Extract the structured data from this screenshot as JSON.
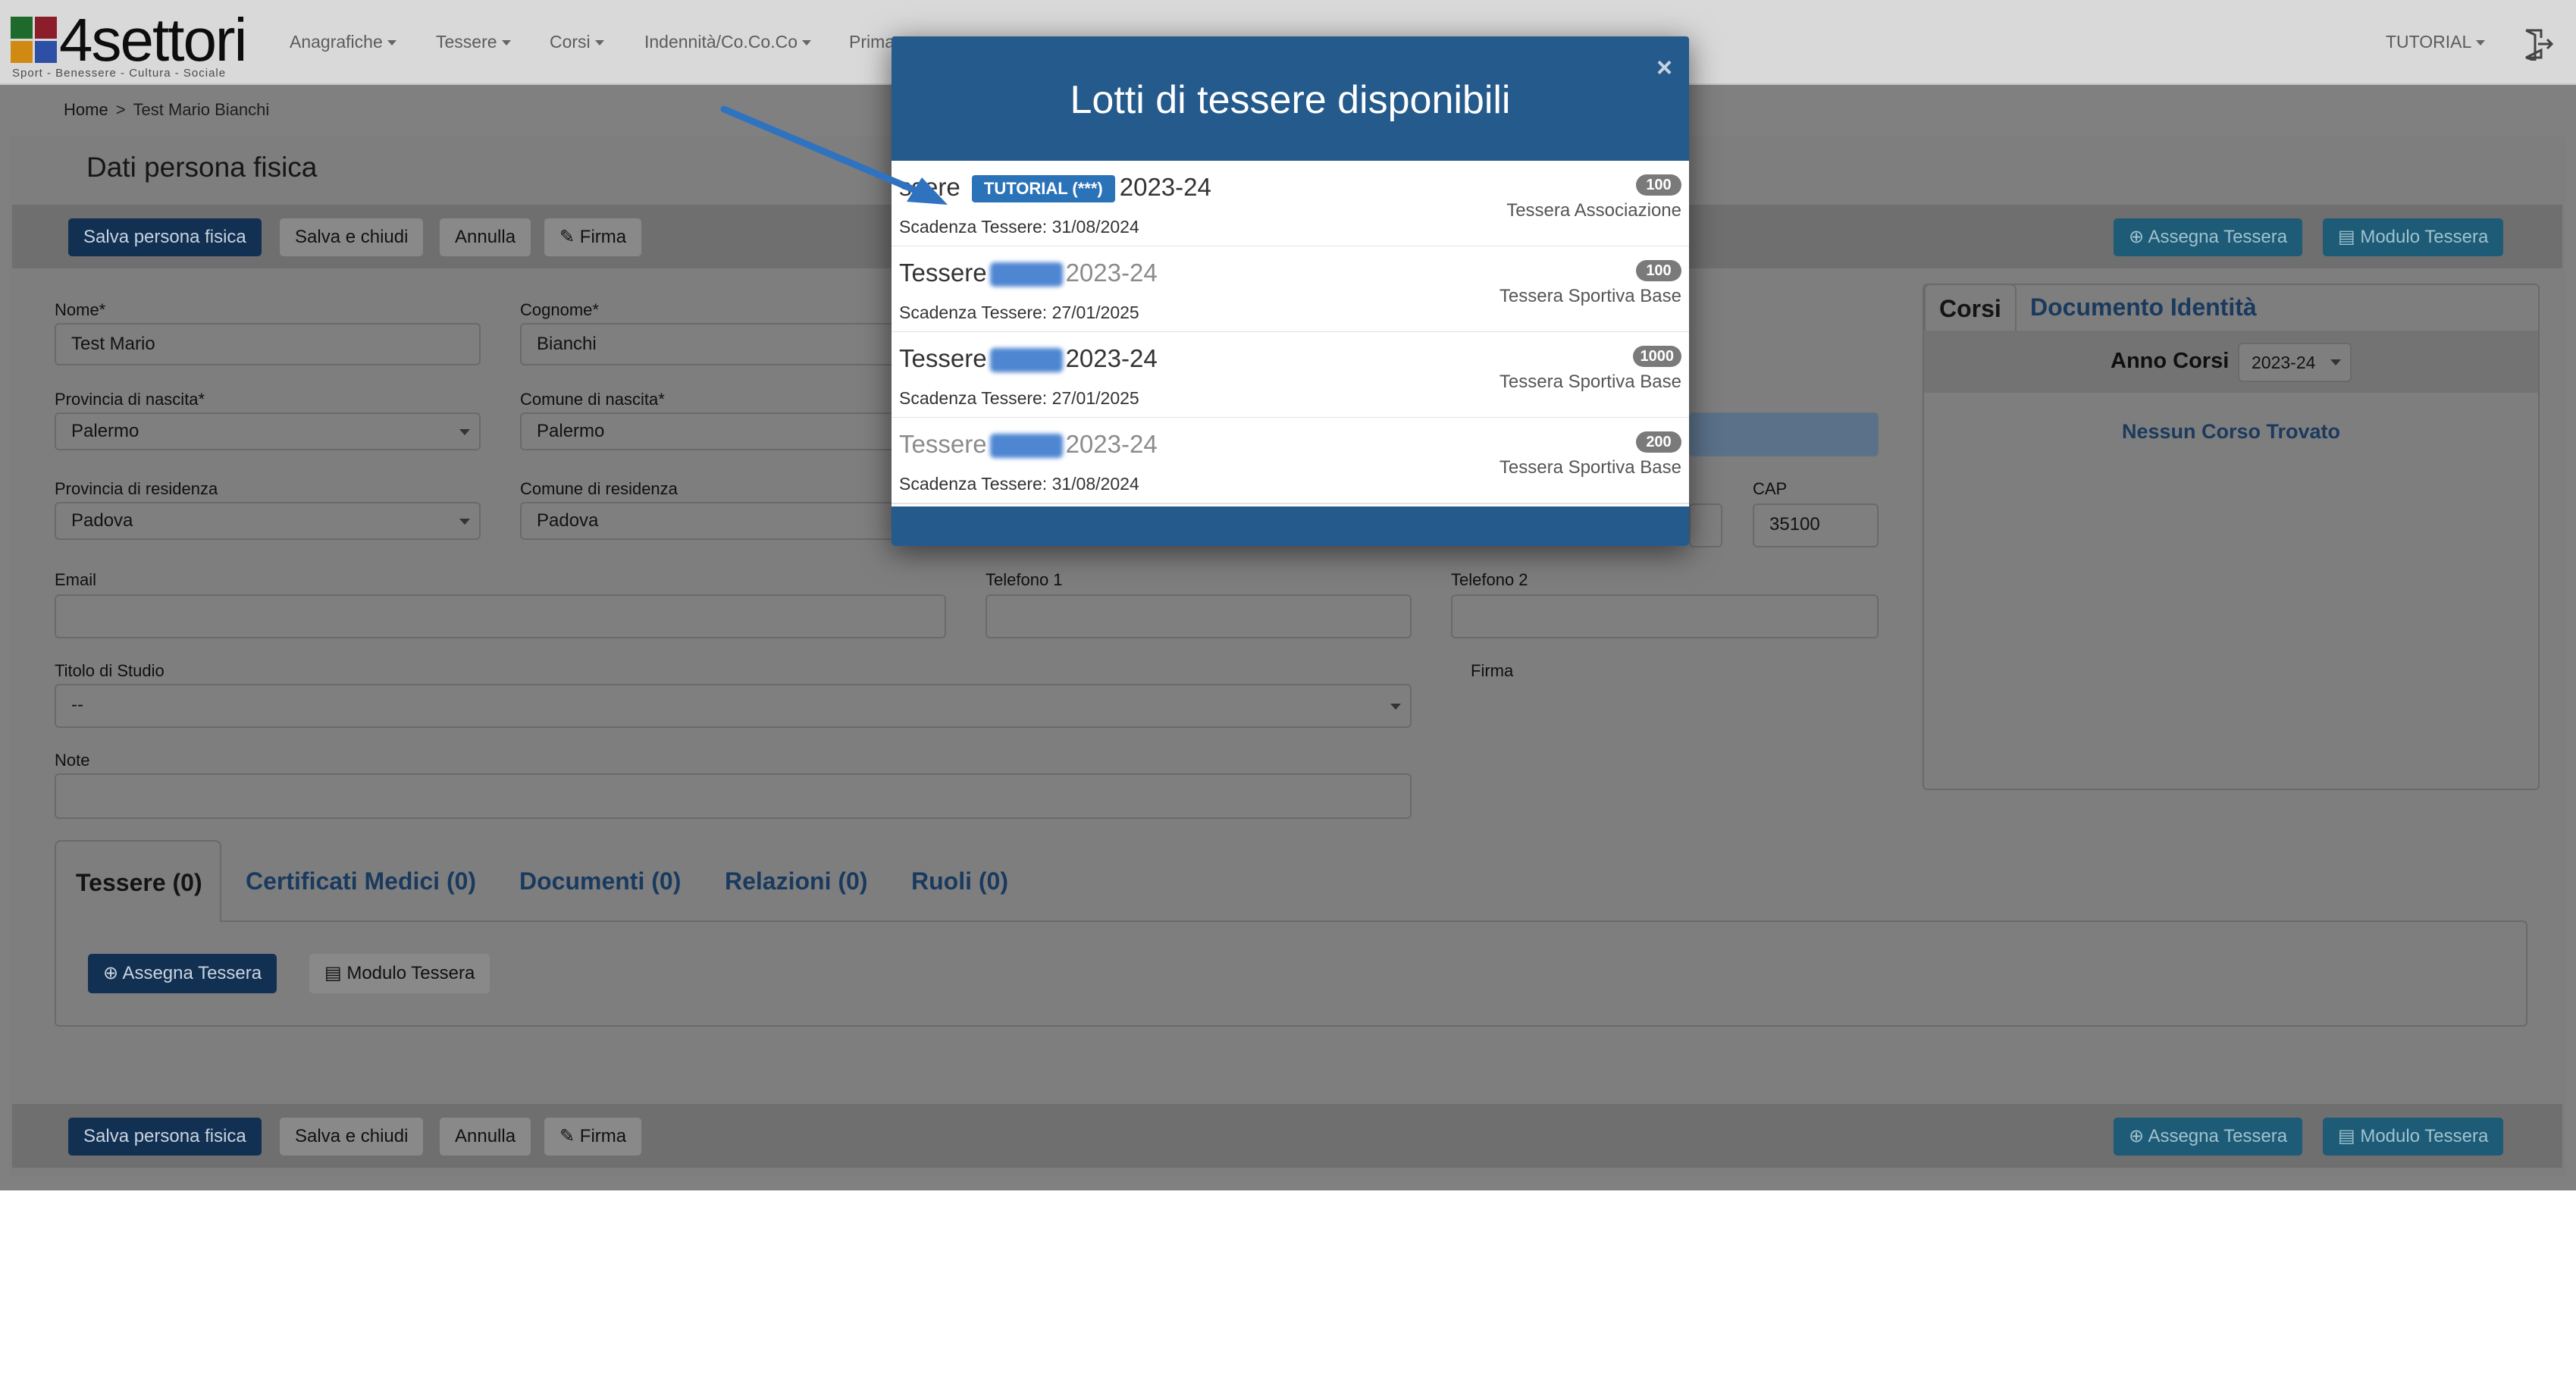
{
  "brand": {
    "name": "4settori",
    "tagline": "Sport - Benessere - Cultura - Sociale"
  },
  "nav": {
    "items": [
      "Anagrafiche",
      "Tessere",
      "Corsi",
      "Indennità/Co.Co.Co",
      "Prima"
    ],
    "user": "TUTORIAL"
  },
  "breadcrumb": {
    "home": "Home",
    "separator": ">",
    "current": "Test Mario Bianchi"
  },
  "page": {
    "title": "Dati persona fisica"
  },
  "toolbar": {
    "save": "Salva persona fisica",
    "save_close": "Salva e chiudi",
    "cancel": "Annulla",
    "sign": "Firma",
    "assign_card": "Assegna Tessera",
    "card_form": "Modulo Tessera"
  },
  "form": {
    "nome_label": "Nome*",
    "nome_value": "Test Mario",
    "cognome_label": "Cognome*",
    "cognome_value": "Bianchi",
    "prov_nascita_label": "Provincia di nascita*",
    "prov_nascita_value": "Palermo",
    "comune_nascita_label": "Comune di nascita*",
    "comune_nascita_value": "Palermo",
    "prov_res_label": "Provincia di residenza",
    "prov_res_value": "Padova",
    "comune_res_label": "Comune di residenza",
    "comune_res_value": "Padova",
    "cap_label": "CAP",
    "cap_value": "35100",
    "email_label": "Email",
    "tel1_label": "Telefono 1",
    "tel2_label": "Telefono 2",
    "titolo_label": "Titolo di Studio",
    "titolo_value": "--",
    "firma_label": "Firma",
    "note_label": "Note"
  },
  "tabs": [
    "Tessere (0)",
    "Certificati Medici (0)",
    "Documenti (0)",
    "Relazioni (0)",
    "Ruoli (0)"
  ],
  "tab_body": {
    "assign": "Assegna Tessera",
    "form": "Modulo Tessera"
  },
  "side": {
    "tab_courses": "Corsi",
    "tab_identity": "Documento Identità",
    "year_label": "Anno Corsi",
    "year_value": "2023-24",
    "empty": "Nessun Corso Trovato"
  },
  "modal": {
    "title": "Lotti di tessere disponibili",
    "close": "×",
    "lots": [
      {
        "prefix": "ssere",
        "tag": "TUTORIAL (***)",
        "suffix": "2023-24",
        "expiry": "Scadenza Tessere: 31/08/2024",
        "count": "100",
        "type": "Tessera Associazione"
      },
      {
        "prefix": "Tessere",
        "suffix": "2023-24",
        "expiry": "Scadenza Tessere: 27/01/2025",
        "count": "100",
        "type": "Tessera Sportiva Base"
      },
      {
        "prefix": "Tessere",
        "suffix": "2023-24",
        "expiry": "Scadenza Tessere: 27/01/2025",
        "count": "1000",
        "type": "Tessera Sportiva Base"
      },
      {
        "prefix": "Tessere",
        "suffix": "2023-24",
        "expiry": "Scadenza Tessere: 31/08/2024",
        "count": "200",
        "type": "Tessera Sportiva Base"
      }
    ]
  },
  "colors": {
    "modal_header": "#245a8c",
    "tag": "#2b73b8",
    "primary": "#123052",
    "arrow": "#2f73c0"
  }
}
